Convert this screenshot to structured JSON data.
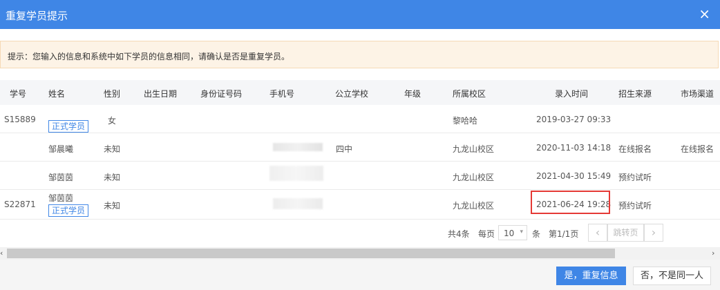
{
  "dialog": {
    "title": "重复学员提示",
    "close_icon": "×"
  },
  "notice": {
    "text": "提示：您输入的信息和系统中如下学员的信息相同，请确认是否是重复学员。"
  },
  "table": {
    "headers": [
      "学号",
      "姓名",
      "性别",
      "出生日期",
      "身份证号码",
      "手机号",
      "公立学校",
      "年级",
      "所属校区",
      "录入时间",
      "招生来源",
      "市场渠道"
    ],
    "rows": [
      {
        "id": "S15889",
        "name": "",
        "badge": "正式学员",
        "gender": "女",
        "campus": "黎哈哈",
        "time": "2019-03-27 09:33",
        "source": "",
        "channel": "",
        "school": ""
      },
      {
        "id": "",
        "name": "邹晨曦",
        "badge": "",
        "gender": "未知",
        "campus": "九龙山校区",
        "time": "2020-11-03 14:18",
        "source": "在线报名",
        "channel": "在线报名",
        "school": "四中"
      },
      {
        "id": "",
        "name": "邹茵茵",
        "badge": "",
        "gender": "未知",
        "campus": "九龙山校区",
        "time": "2021-04-30 15:49",
        "source": "预约试听",
        "channel": "",
        "school": ""
      },
      {
        "id": "S22871",
        "name": "邹茵茵",
        "badge": "正式学员",
        "gender": "未知",
        "campus": "九龙山校区",
        "time": "2021-06-24 19:28",
        "source": "预约试听",
        "channel": "",
        "school": ""
      }
    ]
  },
  "pager": {
    "total": "共4条",
    "per_page_label": "每页",
    "per_page": "10",
    "unit": "条",
    "page_info": "第1/1页",
    "prev_icon": "‹",
    "jump": "跳转页",
    "next_icon": "›",
    "caret": "▾"
  },
  "scroll": {
    "left_icon": "‹",
    "right_icon": "›"
  },
  "footer": {
    "confirm": "是，重复信息",
    "cancel": "否，不是同一人"
  }
}
